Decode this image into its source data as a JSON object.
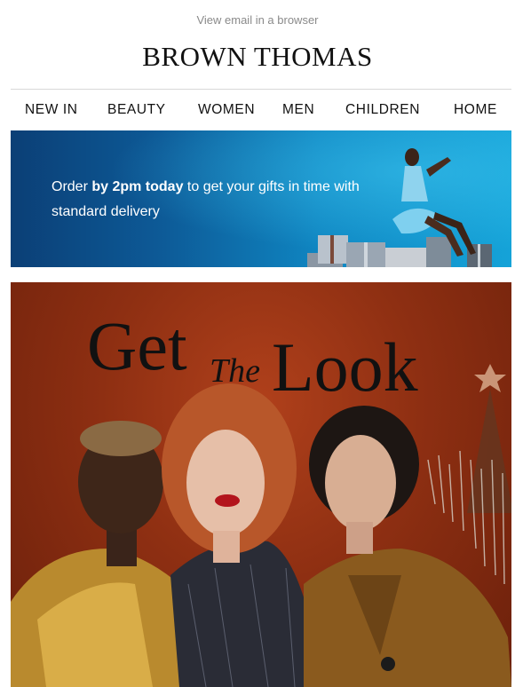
{
  "header": {
    "view_in_browser": "View email in a browser",
    "brand": "BROWN THOMAS"
  },
  "nav": {
    "items": [
      {
        "label": "NEW IN"
      },
      {
        "label": "BEAUTY"
      },
      {
        "label": "WOMEN"
      },
      {
        "label": "MEN"
      },
      {
        "label": "CHILDREN"
      },
      {
        "label": "HOME"
      }
    ]
  },
  "banner": {
    "text_prefix": "Order ",
    "text_bold": "by 2pm today",
    "text_suffix": " to get your gifts in time with standard delivery"
  },
  "hero": {
    "title_get": "Get",
    "title_the": "The",
    "title_look": "Look"
  },
  "colors": {
    "banner_blue": "#0f86c2",
    "hero_red": "#9a3414",
    "text_dark": "#111111",
    "muted": "#8a8a8a"
  }
}
